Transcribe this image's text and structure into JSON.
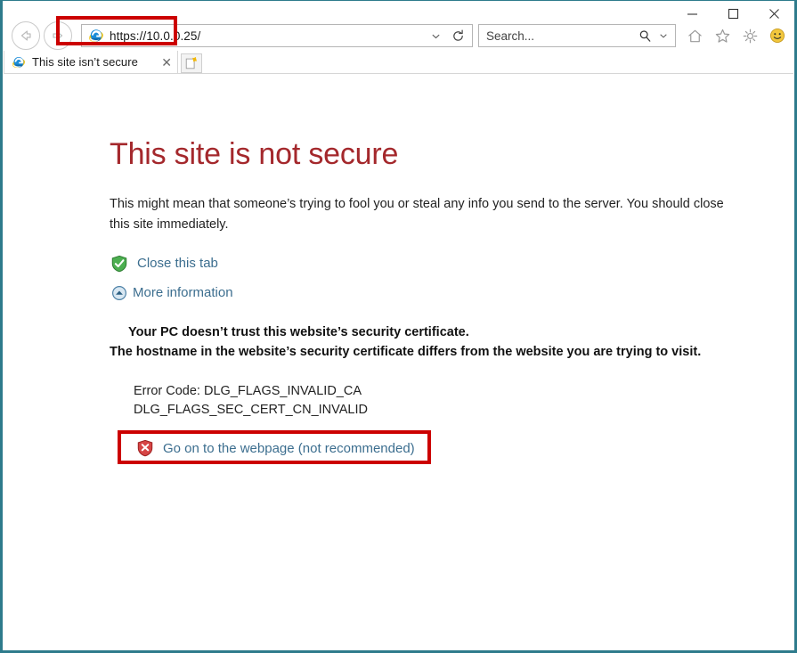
{
  "browser": {
    "window_controls": {
      "minimize_label": "—",
      "maximize_label": "□",
      "close_label": "✕"
    },
    "nav": {
      "back_title": "Back",
      "forward_title": "Forward"
    },
    "address_bar": {
      "url": "https://10.0.0.25/",
      "favicon": "internet-explorer-icon",
      "dropdown_icon": "chevron-down-icon",
      "refresh_icon": "refresh-icon",
      "highlighted": true
    },
    "search": {
      "placeholder": "Search...",
      "search_icon": "search-icon",
      "dropdown_icon": "chevron-down-icon"
    },
    "toolbar_icons": [
      {
        "name": "home-icon",
        "label": "Home"
      },
      {
        "name": "favorites-star-icon",
        "label": "Favorites"
      },
      {
        "name": "gear-icon",
        "label": "Tools"
      },
      {
        "name": "smiley-feedback-icon",
        "label": "Send a Smile"
      }
    ],
    "tabs": [
      {
        "title": "This site isn’t secure",
        "favicon": "internet-explorer-icon",
        "close_label": "✕"
      }
    ],
    "new_tab_label": "New tab"
  },
  "page": {
    "heading": "This site is not secure",
    "description": "This might mean that someone’s trying to fool you or steal any info you send to the server. You should close this site immediately.",
    "actions": [
      {
        "icon": "green-shield-check-icon",
        "label": "Close this tab"
      },
      {
        "icon": "blue-circle-chevron-up-icon",
        "label": "More information"
      }
    ],
    "details": {
      "line1": "Your PC doesn’t trust this website’s security certificate.",
      "line2": "The hostname in the website’s security certificate differs from the website you are trying to visit.",
      "error_code_line1": "Error Code: DLG_FLAGS_INVALID_CA",
      "error_code_line2": "DLG_FLAGS_SEC_CERT_CN_INVALID"
    },
    "go_on_link": {
      "icon": "red-shield-x-icon",
      "label": "Go on to the webpage (not recommended)",
      "highlighted": true
    }
  },
  "colors": {
    "window_border": "#2e7b8c",
    "heading_red": "#a4282c",
    "link_blue": "#3c6e8f",
    "highlight_red": "#cc0000",
    "shield_green": "#3f9c35",
    "shield_red": "#c0392b"
  }
}
